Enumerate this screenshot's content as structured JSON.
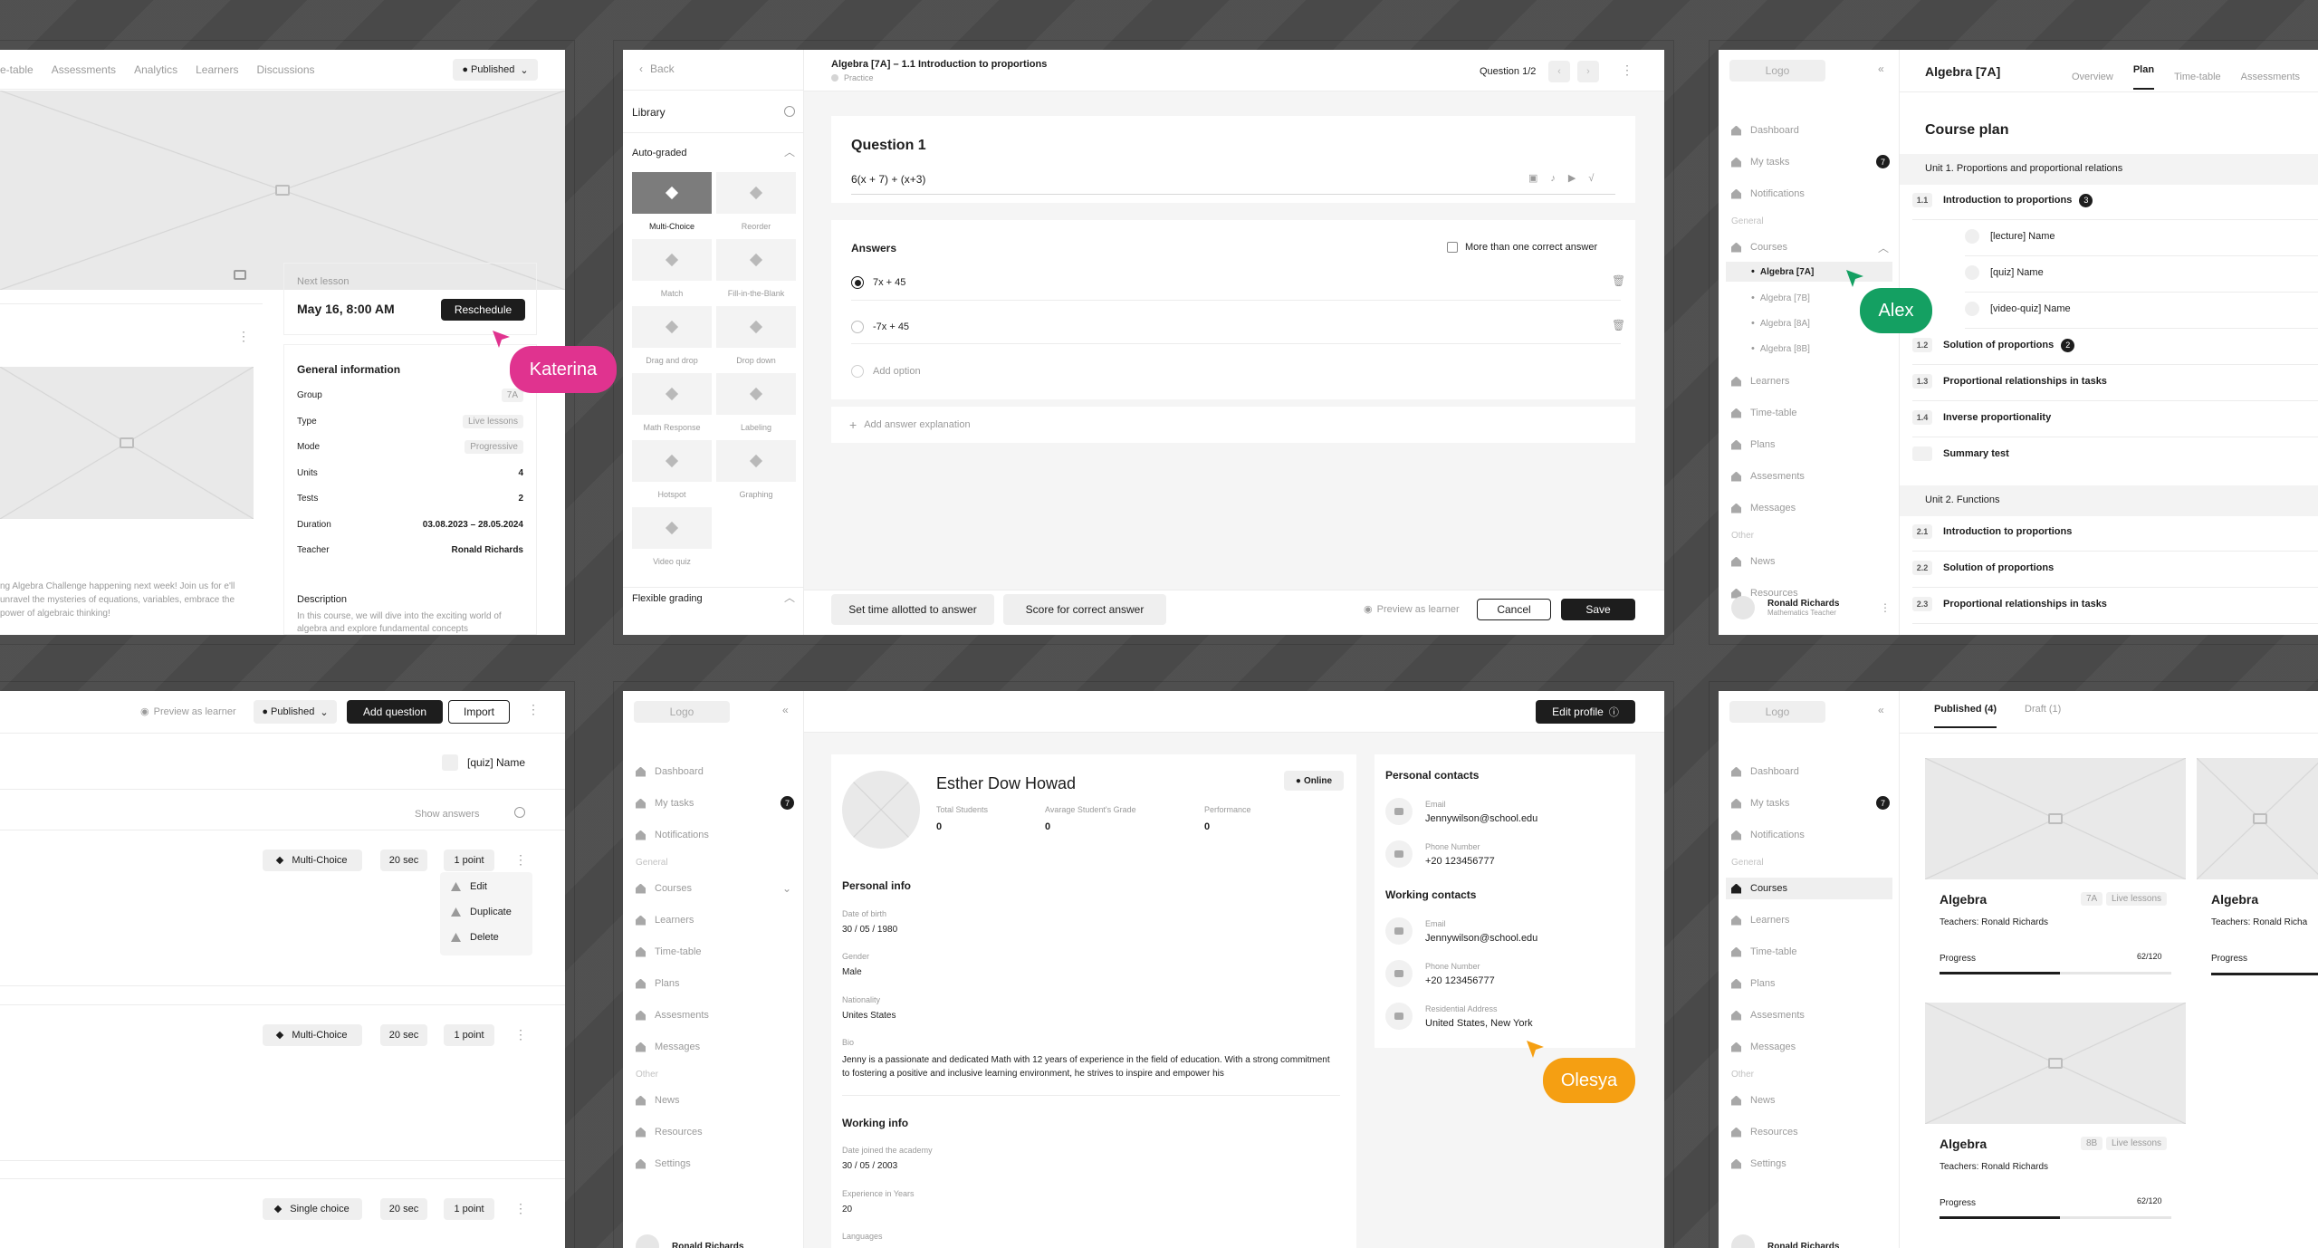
{
  "p1": {
    "tabs": [
      "e-table",
      "Assessments",
      "Analytics",
      "Learners",
      "Discussions"
    ],
    "published": "Published",
    "next_lesson_label": "Next lesson",
    "next_lesson_date": "May 16, 8:00 AM",
    "reschedule": "Reschedule",
    "general_info": "General information",
    "info": [
      {
        "k": "Group",
        "v": "7A",
        "badge": true
      },
      {
        "k": "Type",
        "v": "Live lessons",
        "badge": true
      },
      {
        "k": "Mode",
        "v": "Progressive",
        "badge": true
      },
      {
        "k": "Units",
        "v": "4"
      },
      {
        "k": "Tests",
        "v": "2"
      },
      {
        "k": "Duration",
        "v": "03.08.2023 – 28.05.2024"
      },
      {
        "k": "Teacher",
        "v": "Ronald Richards"
      }
    ],
    "description_label": "Description",
    "description": "In this course, we will dive into the exciting world of algebra and explore fundamental concepts",
    "promo": "ng Algebra Challenge happening next week! Join us for e'll unravel the mysteries of equations, variables, embrace the power of algebraic thinking!"
  },
  "p2": {
    "back": "Back",
    "title": "Algebra [7A] – 1.1 Introduction to proportions",
    "subtitle": "Practice",
    "question_counter": "Question 1/2",
    "library": "Library",
    "auto_graded": "Auto-graded",
    "tiles": [
      "Multi-Choice",
      "Reorder",
      "Match",
      "Fill-in-the-Blank",
      "Drag and drop",
      "Drop down",
      "Math Response",
      "Labeling",
      "Hotspot",
      "Graphing",
      "Video quiz"
    ],
    "flexible_grading": "Flexible grading",
    "question_title": "Question 1",
    "question_text": "6(x + 7) + (x+3)",
    "answers_label": "Answers",
    "multi_correct": "More than one correct answer",
    "answers": [
      "7x + 45",
      "-7x + 45"
    ],
    "add_option": "Add option",
    "add_explanation": "Add answer explanation",
    "set_time": "Set time allotted to answer",
    "score": "Score for correct answer",
    "preview": "Preview as learner",
    "cancel": "Cancel",
    "save": "Save"
  },
  "p3": {
    "logo": "Logo",
    "header_title": "Algebra [7A]",
    "tabs": [
      "Overview",
      "Plan",
      "Time-table",
      "Assessments"
    ],
    "nav": [
      "Dashboard",
      "My tasks",
      "Notifications"
    ],
    "general": "General",
    "courses": "Courses",
    "courses_sub": [
      "Algebra [7A]",
      "Algebra [7B]",
      "Algebra [8A]",
      "Algebra [8B]"
    ],
    "nav2": [
      "Learners",
      "Time-table",
      "Plans",
      "Assesments",
      "Messages"
    ],
    "other": "Other",
    "nav3": [
      "News",
      "Resources"
    ],
    "tasks_count": "7",
    "user_name": "Ronald Richards",
    "user_role": "Mathematics Teacher",
    "course_plan": "Course plan",
    "unit1": "Unit 1. Proportions and proportional relations",
    "u1": [
      {
        "n": "1.1",
        "t": "Introduction to proportions",
        "c": "3"
      },
      {
        "n": "1.2",
        "t": "Solution of proportions",
        "c": "2"
      },
      {
        "n": "1.3",
        "t": "Proportional relationships in tasks"
      },
      {
        "n": "1.4",
        "t": "Inverse proportionality"
      }
    ],
    "sub": [
      "[lecture] Name",
      "[quiz] Name",
      "[video-quiz] Name"
    ],
    "summary": "Summary test",
    "unit2": "Unit 2. Functions",
    "u2": [
      {
        "n": "2.1",
        "t": "Introduction to proportions"
      },
      {
        "n": "2.2",
        "t": "Solution of proportions"
      },
      {
        "n": "2.3",
        "t": "Proportional relationships in tasks"
      }
    ]
  },
  "p4": {
    "preview": "Preview as learner",
    "published": "Published",
    "add_question": "Add question",
    "import": "Import",
    "quiz_name": "[quiz] Name",
    "show_answers": "Show answers",
    "rows": [
      {
        "type": "Multi-Choice",
        "time": "20 sec",
        "points": "1 point"
      },
      {
        "type": "Multi-Choice",
        "time": "20 sec",
        "points": "1 point"
      },
      {
        "type": "Single choice",
        "time": "20 sec",
        "points": "1 point"
      }
    ],
    "menu": [
      "Edit",
      "Duplicate",
      "Delete"
    ]
  },
  "p5": {
    "logo": "Logo",
    "edit_profile": "Edit profile",
    "name": "Esther Dow Howad",
    "online": "Online",
    "stats": [
      {
        "l": "Total Students",
        "v": "0"
      },
      {
        "l": "Avarage Student's Grade",
        "v": "0"
      },
      {
        "l": "Performance",
        "v": "0"
      }
    ],
    "personal_info": "Personal info",
    "dob_label": "Date of birth",
    "dob": "30 / 05 / 1980",
    "gender_label": "Gender",
    "gender": "Male",
    "nat_label": "Nationality",
    "nat": "Unites States",
    "bio_label": "Bio",
    "bio": "Jenny is a passionate and dedicated Math with 12 years of experience in the field of education. With a strong commitment to fostering a positive and inclusive learning environment, he strives to inspire and empower his",
    "working_info": "Working info",
    "joined_label": "Date joined the academy",
    "joined": "30 / 05 / 2003",
    "exp_label": "Experience in Years",
    "exp": "20",
    "lang_label": "Languages",
    "personal_contacts": "Personal contacts",
    "working_contacts": "Working contacts",
    "email_label": "Email",
    "email": "Jennywilson@school.edu",
    "phone_label": "Phone Number",
    "phone": "+20 123456777",
    "addr_label": "Residential Address",
    "addr": "United States, New York",
    "nav": [
      "Dashboard",
      "My tasks",
      "Notifications"
    ],
    "general": "General",
    "courses": "Courses",
    "nav2": [
      "Learners",
      "Time-table",
      "Plans",
      "Assesments",
      "Messages"
    ],
    "other": "Other",
    "nav3": [
      "News",
      "Resources",
      "Settings"
    ],
    "tasks_count": "7",
    "user_name": "Ronald Richards"
  },
  "p6": {
    "logo": "Logo",
    "tab_published": "Published (4)",
    "tab_draft": "Draft (1)",
    "nav": [
      "Dashboard",
      "My tasks",
      "Notifications"
    ],
    "general": "General",
    "courses": "Courses",
    "nav2": [
      "Learners",
      "Time-table",
      "Plans",
      "Assesments",
      "Messages"
    ],
    "other": "Other",
    "nav3": [
      "News",
      "Resources",
      "Settings"
    ],
    "tasks_count": "7",
    "user_name": "Ronald Richards",
    "cards": [
      {
        "title": "Algebra",
        "group": "7A",
        "type": "Live lessons",
        "teacher": "Teachers: Ronald Richards",
        "progress_label": "Progress",
        "progress": "62/120",
        "pct": 0.52
      },
      {
        "title": "Algebra",
        "group": "8B",
        "type": "Live lessons",
        "teacher": "Teachers: Ronald Richards",
        "progress_label": "Progress",
        "progress": "62/120",
        "pct": 0.52
      }
    ],
    "card2_title": "Algebra",
    "card2_teacher": "Teachers: Ronald Richa",
    "card2_progress": "Progress"
  },
  "tags": {
    "katerina": "Katerina",
    "alex": "Alex",
    "olesya": "Olesya"
  },
  "colors": {
    "katerina": "#e0338f",
    "alex": "#14a062",
    "olesya": "#f59f12",
    "dark": "#1d1d1d"
  }
}
